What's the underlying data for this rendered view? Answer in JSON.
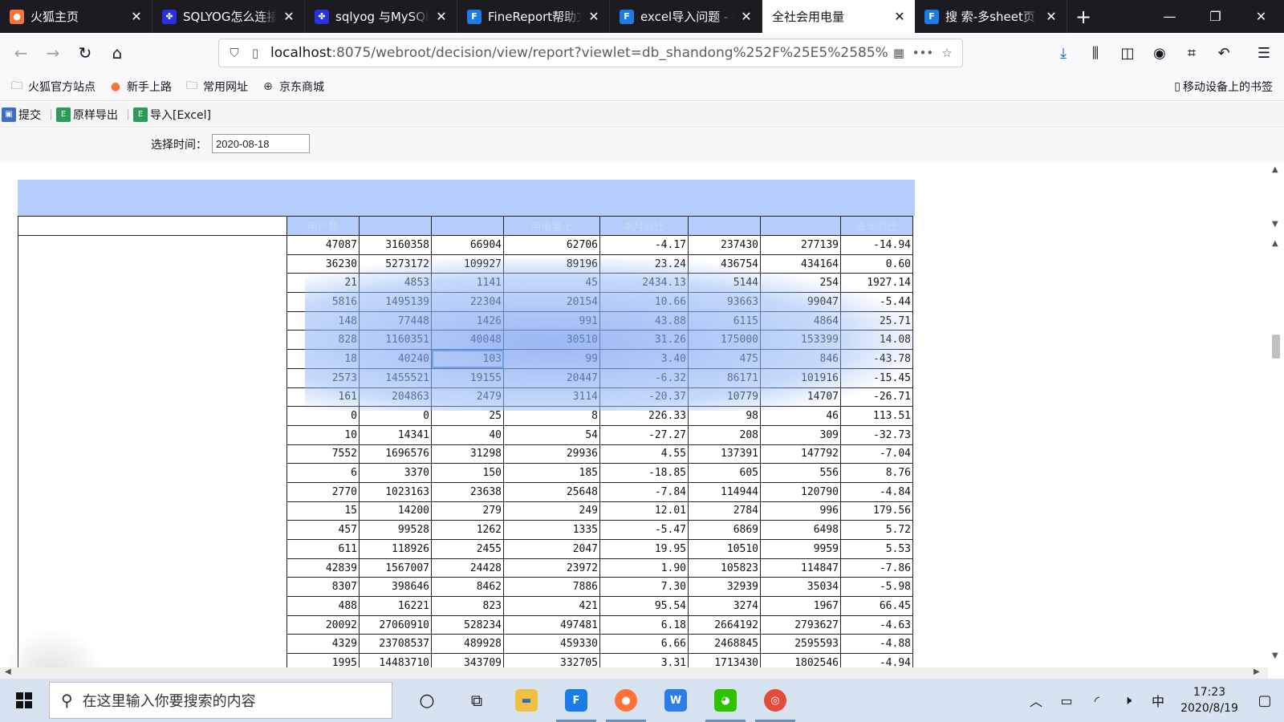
{
  "browser": {
    "tabs": [
      {
        "title": "火狐主页",
        "icon": "firefox-icon",
        "color": "#ff7139",
        "glyph": "●"
      },
      {
        "title": "SQLYOG怎么连接",
        "icon": "baidu-paw-icon",
        "color": "#2932e1",
        "glyph": "✤"
      },
      {
        "title": "sqlyog 与MySQL",
        "icon": "baidu-paw-icon",
        "color": "#2932e1",
        "glyph": "✤"
      },
      {
        "title": "FineReport帮助文",
        "icon": "finereport-icon",
        "color": "#1c7ce6",
        "glyph": "F"
      },
      {
        "title": "excel导入问题 - (",
        "icon": "finereport-icon",
        "color": "#1c7ce6",
        "glyph": "F"
      },
      {
        "title": "全社会用电量",
        "icon": "",
        "color": "",
        "glyph": ""
      },
      {
        "title": "搜 索-多sheet页",
        "icon": "finereport-icon",
        "color": "#1c7ce6",
        "glyph": "F"
      }
    ],
    "active_tab": 5,
    "url_host": "localhost",
    "url_path": ":8075/webroot/decision/view/report?viewlet=db_shandong%252F%25E5%2585%",
    "bookmarks": [
      {
        "label": "火狐官方站点",
        "icon": "folder-icon"
      },
      {
        "label": "新手上路",
        "icon": "firefox-icon"
      },
      {
        "label": "常用网址",
        "icon": "folder-icon"
      },
      {
        "label": "京东商城",
        "icon": "globe-icon"
      }
    ],
    "mobile_bookmarks": "移动设备上的书签"
  },
  "report_toolbar": {
    "submit": "提交",
    "export": "原样导出",
    "import": "导入[Excel]"
  },
  "params": {
    "label": "选择时间：",
    "date_value": "2020-08-18"
  },
  "table": {
    "headers": [
      "用户数",
      "",
      "",
      "用电量上",
      "本月同比",
      "",
      "",
      "去年同比"
    ],
    "rows": [
      [
        "47087",
        "3160358",
        "66904",
        "62706",
        "-4.17",
        "237430",
        "277139",
        "-14.94"
      ],
      [
        "36230",
        "5273172",
        "109927",
        "89196",
        "23.24",
        "436754",
        "434164",
        "0.60"
      ],
      [
        "21",
        "4853",
        "1141",
        "45",
        "2434.13",
        "5144",
        "254",
        "1927.14"
      ],
      [
        "5816",
        "1495139",
        "22304",
        "20154",
        "10.66",
        "93663",
        "99047",
        "-5.44"
      ],
      [
        "148",
        "77448",
        "1426",
        "991",
        "43.88",
        "6115",
        "4864",
        "25.71"
      ],
      [
        "828",
        "1160351",
        "40048",
        "30510",
        "31.26",
        "175000",
        "153399",
        "14.08"
      ],
      [
        "18",
        "40240",
        "103",
        "99",
        "3.40",
        "475",
        "846",
        "-43.78"
      ],
      [
        "2573",
        "1455521",
        "19155",
        "20447",
        "-6.32",
        "86171",
        "101916",
        "-15.45"
      ],
      [
        "161",
        "204863",
        "2479",
        "3114",
        "-20.37",
        "10779",
        "14707",
        "-26.71"
      ],
      [
        "0",
        "0",
        "25",
        "8",
        "226.33",
        "98",
        "46",
        "113.51"
      ],
      [
        "10",
        "14341",
        "40",
        "54",
        "-27.27",
        "208",
        "309",
        "-32.73"
      ],
      [
        "7552",
        "1696576",
        "31298",
        "29936",
        "4.55",
        "137391",
        "147792",
        "-7.04"
      ],
      [
        "6",
        "3370",
        "150",
        "185",
        "-18.85",
        "605",
        "556",
        "8.76"
      ],
      [
        "2770",
        "1023163",
        "23638",
        "25648",
        "-7.84",
        "114944",
        "120790",
        "-4.84"
      ],
      [
        "15",
        "14200",
        "279",
        "249",
        "12.01",
        "2784",
        "996",
        "179.56"
      ],
      [
        "457",
        "99528",
        "1262",
        "1335",
        "-5.47",
        "6869",
        "6498",
        "5.72"
      ],
      [
        "611",
        "118926",
        "2455",
        "2047",
        "19.95",
        "10510",
        "9959",
        "5.53"
      ],
      [
        "42839",
        "1567007",
        "24428",
        "23972",
        "1.90",
        "105823",
        "114847",
        "-7.86"
      ],
      [
        "8307",
        "398646",
        "8462",
        "7886",
        "7.30",
        "32939",
        "35034",
        "-5.98"
      ],
      [
        "488",
        "16221",
        "823",
        "421",
        "95.54",
        "3274",
        "1967",
        "66.45"
      ],
      [
        "20092",
        "27060910",
        "528234",
        "497481",
        "6.18",
        "2664192",
        "2793627",
        "-4.63"
      ],
      [
        "4329",
        "23708537",
        "489928",
        "459330",
        "6.66",
        "2468845",
        "2595593",
        "-4.88"
      ],
      [
        "1995",
        "14483710",
        "343709",
        "332705",
        "3.31",
        "1713430",
        "1802546",
        "-4.94"
      ]
    ]
  },
  "taskbar": {
    "search_placeholder": "在这里输入你要搜索的内容",
    "ime": "中",
    "time": "17:23",
    "date": "2020/8/19"
  }
}
